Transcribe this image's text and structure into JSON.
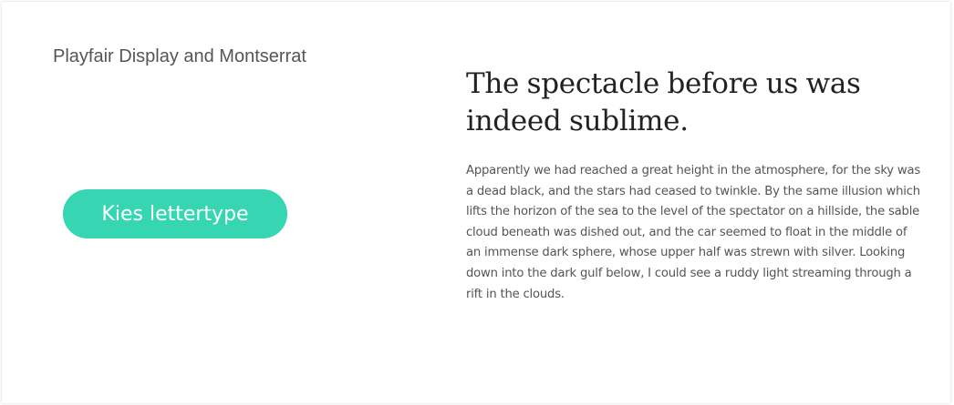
{
  "font_pair": {
    "name": "Playfair Display and Montserrat"
  },
  "button": {
    "label": "Kies lettertype",
    "color": "#35d6b1"
  },
  "preview": {
    "headline": "The spectacle before us was indeed sublime.",
    "body": "Apparently we had reached a great height in the atmosphere, for the sky was a dead black, and the stars had ceased to twinkle. By the same illusion which lifts the horizon of the sea to the level of the spectator on a hillside, the sable cloud beneath was dished out, and the car seemed to float in the middle of an immense dark sphere, whose upper half was strewn with silver. Looking down into the dark gulf below, I could see a ruddy light streaming through a rift in the clouds."
  }
}
